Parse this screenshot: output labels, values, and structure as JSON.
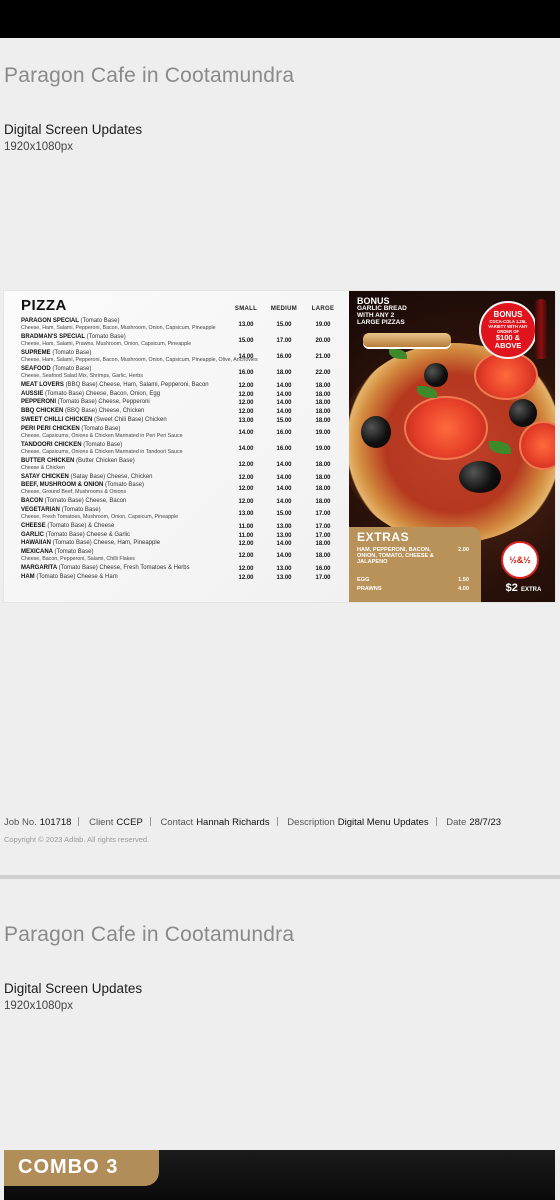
{
  "sections": [
    {
      "title": "Paragon Cafe in Cootamundra",
      "subtitle": "Digital Screen Updates",
      "dimensions": "1920x1080px",
      "meta": {
        "job_label": "Job No.",
        "job_value": "101718",
        "client_label": "Client",
        "client_value": "CCEP",
        "contact_label": "Contact",
        "contact_value": "Hannah Richards",
        "description_label": "Description",
        "description_value": "Digital Menu Updates",
        "date_label": "Date",
        "date_value": "28/7/23"
      },
      "copyright": "Copyright © 2023 Adlab. All rights reserved."
    },
    {
      "title": "Paragon Cafe in Cootamundra",
      "subtitle": "Digital Screen Updates",
      "dimensions": "1920x1080px",
      "combo_label": "COMBO 3"
    }
  ],
  "menu": {
    "heading": "PIZZA",
    "sizes": [
      "SMALL",
      "MEDIUM",
      "LARGE"
    ],
    "items": [
      {
        "name": "PARAGON SPECIAL",
        "base": "(Tomato Base)",
        "desc": "Cheese, Ham, Salami, Pepperoni, Bacon, Mushroom, Onion, Capsicum, Pineapple",
        "prices": [
          "13.00",
          "15.00",
          "19.00"
        ]
      },
      {
        "name": "BRADMAN'S SPECIAL",
        "base": "(Tomato Base)",
        "desc": "Cheese, Ham, Salami, Prawns, Mushroom, Onion, Capsicum, Pineapple",
        "prices": [
          "15.00",
          "17.00",
          "20.00"
        ]
      },
      {
        "name": "SUPREME",
        "base": "(Tomato Base)",
        "desc": "Cheese, Ham, Salami, Pepperoni, Bacon, Mushroom, Onion, Capsicum, Pineapple, Olive, Anchovies",
        "prices": [
          "14.00",
          "16.00",
          "21.00"
        ]
      },
      {
        "name": "SEAFOOD",
        "base": "(Tomato Base)",
        "desc": "Cheese, Seafood Salad Mix, Shrimps, Garlic, Herbs",
        "prices": [
          "16.00",
          "18.00",
          "22.00"
        ]
      },
      {
        "name": "MEAT LOVERS",
        "base": "(BBQ Base) Cheese, Ham, Salami, Pepperoni, Bacon",
        "desc": "",
        "prices": [
          "12.00",
          "14.00",
          "18.00"
        ]
      },
      {
        "name": "AUSSIE",
        "base": "(Tomato Base) Cheese, Bacon, Onion, Egg",
        "desc": "",
        "prices": [
          "12.00",
          "14.00",
          "18.00"
        ]
      },
      {
        "name": "PEPPERONI",
        "base": "(Tomato Base) Cheese, Pepperoni",
        "desc": "",
        "prices": [
          "12.00",
          "14.00",
          "18.00"
        ]
      },
      {
        "name": "BBQ CHICKEN",
        "base": "(BBQ Base) Cheese, Chicken",
        "desc": "",
        "prices": [
          "12.00",
          "14.00",
          "18.00"
        ]
      },
      {
        "name": "SWEET CHILLI CHICKEN",
        "base": "(Sweet Chili Base) Chicken",
        "desc": "",
        "prices": [
          "13.00",
          "15.00",
          "18.00"
        ]
      },
      {
        "name": "PERI PERI CHICKEN",
        "base": "(Tomato Base)",
        "desc": "Cheese, Capsicums, Onions & Chicken Marinated in Peri Peri Sauce",
        "prices": [
          "14.00",
          "16.00",
          "19.00"
        ]
      },
      {
        "name": "TANDOORI CHICKEN",
        "base": "(Tomato Base)",
        "desc": "Cheese, Capsicums, Onions & Chicken Marinated in Tandoori Sauce",
        "prices": [
          "14.00",
          "16.00",
          "19.00"
        ]
      },
      {
        "name": "BUTTER CHICKEN",
        "base": "(Butter Chicken Base)",
        "desc": "Cheese & Chicken",
        "prices": [
          "12.00",
          "14.00",
          "18.00"
        ]
      },
      {
        "name": "SATAY CHICKEN",
        "base": "(Satay Base) Cheese, Chicken",
        "desc": "",
        "prices": [
          "12.00",
          "14.00",
          "18.00"
        ]
      },
      {
        "name": "BEEF, MUSHROOM & ONION",
        "base": "(Tomato Base)",
        "desc": "Cheese, Ground Beef, Mushrooms & Onions",
        "prices": [
          "12.00",
          "14.00",
          "18.00"
        ]
      },
      {
        "name": "BACON",
        "base": "(Tomato Base) Cheese, Bacon",
        "desc": "",
        "prices": [
          "12.00",
          "14.00",
          "18.00"
        ]
      },
      {
        "name": "VEGETARIAN",
        "base": "(Tomato Base)",
        "desc": "Cheese, Fresh Tomatoes, Mushroom, Onion, Capsicum, Pineapple",
        "prices": [
          "13.00",
          "15.00",
          "17.00"
        ]
      },
      {
        "name": "CHEESE",
        "base": "(Tomato Base) & Cheese",
        "desc": "",
        "prices": [
          "11.00",
          "13.00",
          "17.00"
        ]
      },
      {
        "name": "GARLIC",
        "base": "(Tomato Base) Cheese & Garlic",
        "desc": "",
        "prices": [
          "11.00",
          "13.00",
          "17.00"
        ]
      },
      {
        "name": "HAWAIIAN",
        "base": "(Tomato Base) Cheese, Ham, Pineapple",
        "desc": "",
        "prices": [
          "12.00",
          "14.00",
          "18.00"
        ]
      },
      {
        "name": "MEXICANA",
        "base": "(Tomato Base)",
        "desc": "Cheese, Bacon, Pepperoni, Salami, Chilli Flakes",
        "prices": [
          "12.00",
          "14.00",
          "18.00"
        ]
      },
      {
        "name": "MARGARITA",
        "base": "(Tomato Base) Cheese, Fresh Tomatoes & Herbs",
        "desc": "",
        "prices": [
          "12.00",
          "13.00",
          "16.00"
        ]
      },
      {
        "name": "HAM",
        "base": "(Tomato Base) Cheese & Ham",
        "desc": "",
        "prices": [
          "12.00",
          "13.00",
          "17.00"
        ]
      }
    ],
    "bonus": {
      "title": "BONUS",
      "lines": [
        "GARLIC BREAD",
        "WITH ANY 2",
        "LARGE PIZZAS"
      ],
      "badge_title": "BONUS",
      "badge_text": "COCA-COLA 1.25L VARIETY WITH ANY ORDER OF",
      "badge_amount": "$100 &",
      "badge_above": "ABOVE"
    },
    "extras": {
      "title": "EXTRAS",
      "items": [
        {
          "label": "HAM, PEPPERONI, BACON, ONION, TOMATO, CHEESE & JALAPENO",
          "price": "2.00"
        },
        {
          "label": "EGG",
          "price": "1.50"
        },
        {
          "label": "PRAWNS",
          "price": "4.00"
        }
      ]
    },
    "half_badge": "½&½",
    "half_price": "$2",
    "half_extra": "EXTRA"
  },
  "colors": {
    "accent_gold": "#b9925a",
    "badge_red": "#e0141c",
    "title_grey": "#8a8a8a"
  }
}
